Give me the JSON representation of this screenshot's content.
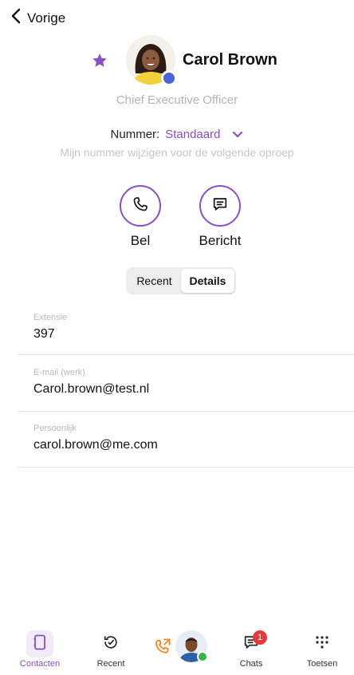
{
  "nav": {
    "back_label": "Vorige"
  },
  "contact": {
    "name": "Carol Brown",
    "title": "Chief Executive Officer",
    "favorite": true,
    "presence_color": "#4a63d8"
  },
  "number": {
    "label": "Nummer:",
    "value": "Standaard",
    "hint": "Mijn nummer wijzigen voor de volgende oproep"
  },
  "actions": {
    "call_label": "Bel",
    "message_label": "Bericht"
  },
  "segments": {
    "recent": "Recent",
    "details": "Details",
    "active": "Details"
  },
  "details": [
    {
      "label": "Extensie",
      "value": "397"
    },
    {
      "label": "E-mail (werk)",
      "value": "Carol.brown@test.nl"
    },
    {
      "label": "Persoonlijk",
      "value": "carol.brown@me.com"
    }
  ],
  "tabbar": {
    "contacts": "Contacten",
    "recent": "Recent",
    "chats": "Chats",
    "chats_badge": "1",
    "keypad": "Toetsen",
    "active": "Contacten"
  },
  "colors": {
    "accent": "#8a4fc6",
    "badge": "#e23b3b",
    "available": "#37b24d",
    "call_orange": "#f08a24"
  }
}
